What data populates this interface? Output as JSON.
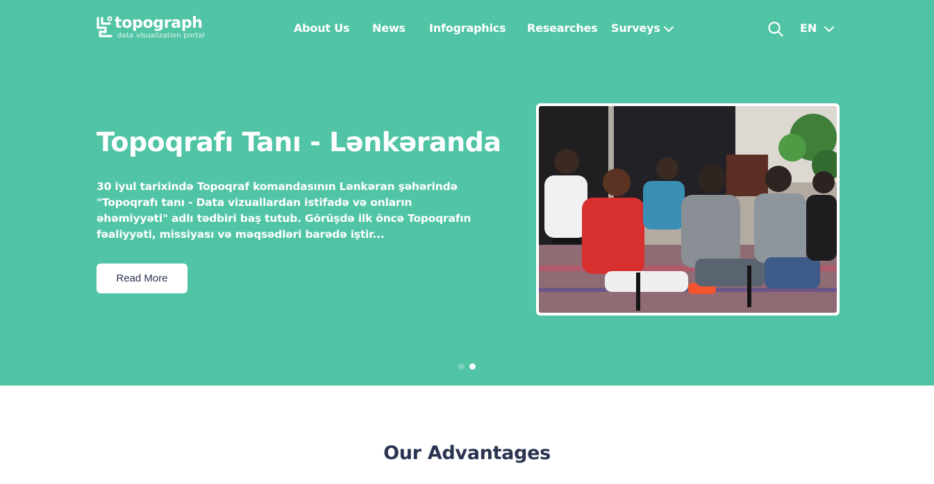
{
  "header": {
    "logo_name": "topograph",
    "logo_tagline": "data visualization portal",
    "nav": [
      "About Us",
      "News",
      "Infographics",
      "Researches",
      "Surveys"
    ],
    "language": "EN"
  },
  "hero": {
    "title": "Topoqrafı Tanı - Lənkəranda",
    "text": "30 iyul tarixində Topoqraf komandasının Lənkəran şəhərində \"Topoqrafı tanı - Data vizuallardan istifadə və onların əhəmiyyəti\" adlı tədbiri baş tutub. Görüşdə ilk öncə Topoqrafın fəaliyyəti, missiyası və məqsədləri barədə iştir...",
    "button_label": "Read More",
    "slides_total": 2,
    "slide_active": 2
  },
  "advantages": {
    "title": "Our Advantages"
  },
  "colors": {
    "brand": "#51c4a6",
    "heading": "#2a3350"
  },
  "icons": [
    "topograph-logo-icon",
    "search-icon",
    "chevron-down-icon"
  ]
}
